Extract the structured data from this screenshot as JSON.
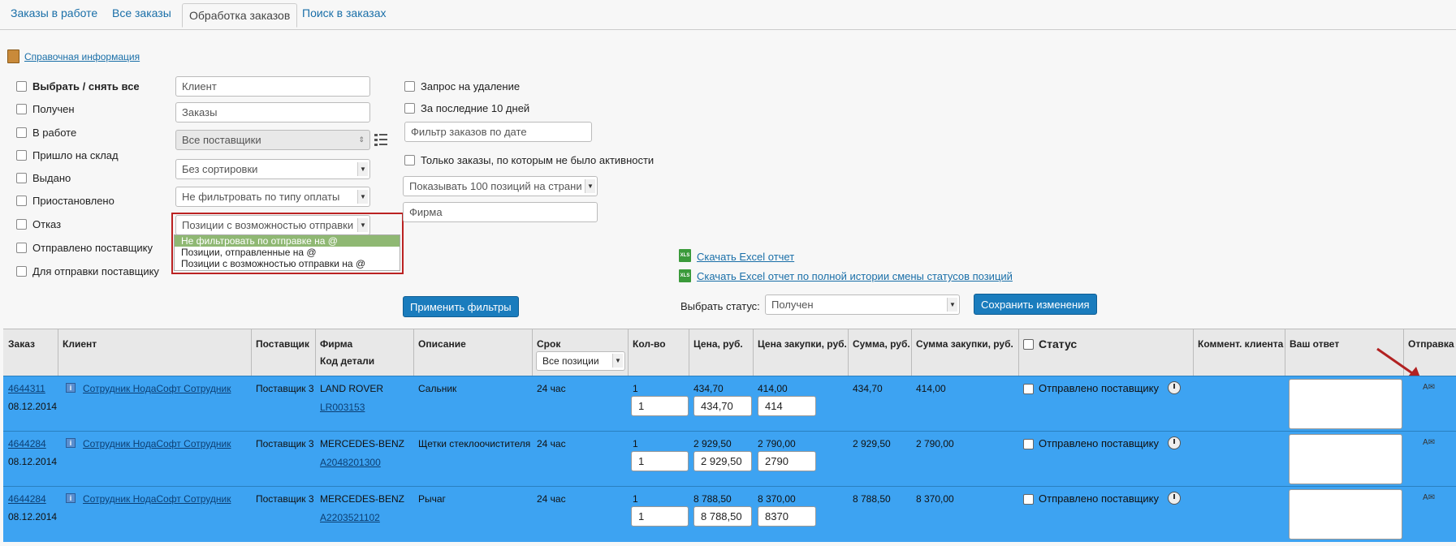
{
  "tabs": [
    "Заказы в работе",
    "Все заказы",
    "Обработка заказов",
    "Поиск в заказах"
  ],
  "help_link": "Справочная информация",
  "status_checks": [
    "Выбрать / снять все",
    "Получен",
    "В работе",
    "Пришло на склад",
    "Выдано",
    "Приостановлено",
    "Отказ",
    "Отправлено поставщику",
    "Для отправки поставщику"
  ],
  "filters": {
    "client_placeholder": "Клиент",
    "orders_placeholder": "Заказы",
    "suppliers": "Все поставщики",
    "sorting": "Без сортировки",
    "payment_filter": "Не фильтровать по типу оплаты",
    "email_filter": "Позиции с возможностью отправки",
    "email_options": [
      "Не фильтровать по отправке на @",
      "Позиции, отправленные на @",
      "Позиции с возможностью отправки на @"
    ],
    "delete_request": "Запрос на удаление",
    "last10": "За последние 10 дней",
    "date_filter_placeholder": "Фильтр заказов по дате",
    "inactive": "Только заказы, по которым не было активности",
    "per_page": "Показывать 100 позиций на страни",
    "firm_placeholder": "Фирма",
    "apply_label": "Применить фильтры"
  },
  "excel": {
    "icon": "XLS",
    "report": "Скачать Excel отчет",
    "history_report": "Скачать Excel отчет по полной истории смены статусов позиций"
  },
  "status_select": {
    "label": "Выбрать статус:",
    "value": "Получен",
    "save_label": "Сохранить изменения"
  },
  "table": {
    "headers": {
      "order": "Заказ",
      "client": "Клиент",
      "supplier": "Поставщик",
      "firm": "Фирма",
      "part_code": "Код детали",
      "description": "Описание",
      "term": "Срок",
      "term_filter": "Все позиции",
      "qty": "Кол-во",
      "price": "Цена, руб.",
      "purchase_price": "Цена закупки, руб.",
      "sum": "Сумма, руб.",
      "purchase_sum": "Сумма закупки, руб.",
      "status": "Статус",
      "client_comment": "Коммент. клиента",
      "answer": "Ваш ответ",
      "send": "Отправка"
    },
    "rows": [
      {
        "order": "4644311",
        "date": "08.12.2014",
        "client": "Сотрудник НодаСофт Сотрудник",
        "supplier": "Поставщик 3",
        "firm": "LAND ROVER",
        "code": "LR003153",
        "desc": "Сальник",
        "term": "24 час",
        "qty": "1",
        "qty_input": "1",
        "price": "434,70",
        "price_input": "434,70",
        "purchase": "414,00",
        "purchase_input": "414",
        "sum": "434,70",
        "purchase_sum": "414,00",
        "status": "Отправлено поставщику"
      },
      {
        "order": "4644284",
        "date": "08.12.2014",
        "client": "Сотрудник НодаСофт Сотрудник",
        "supplier": "Поставщик 3",
        "firm": "MERCEDES-BENZ",
        "code": "A2048201300",
        "desc": "Щетки стеклоочистителя",
        "term": "24 час",
        "qty": "1",
        "qty_input": "1",
        "price": "2 929,50",
        "price_input": "2 929,50",
        "purchase": "2 790,00",
        "purchase_input": "2790",
        "sum": "2 929,50",
        "purchase_sum": "2 790,00",
        "status": "Отправлено поставщику"
      },
      {
        "order": "4644284",
        "date": "08.12.2014",
        "client": "Сотрудник НодаСофт Сотрудник",
        "supplier": "Поставщик 3",
        "firm": "MERCEDES-BENZ",
        "code": "A2203521102",
        "desc": "Рычаг",
        "term": "24 час",
        "qty": "1",
        "qty_input": "1",
        "price": "8 788,50",
        "price_input": "8 788,50",
        "purchase": "8 370,00",
        "purchase_input": "8370",
        "sum": "8 788,50",
        "purchase_sum": "8 370,00",
        "status": "Отправлено поставщику"
      }
    ]
  },
  "colors": {
    "row_bg": "#3da3f2",
    "button": "#1a7cbd",
    "highlight": "#8fb873",
    "annotation": "#b22222"
  },
  "icons": {
    "help": "book-icon",
    "excel": "xls-icon",
    "clock": "clock-icon",
    "mail": "mail-icon",
    "info": "info-icon",
    "list": "list-icon"
  }
}
